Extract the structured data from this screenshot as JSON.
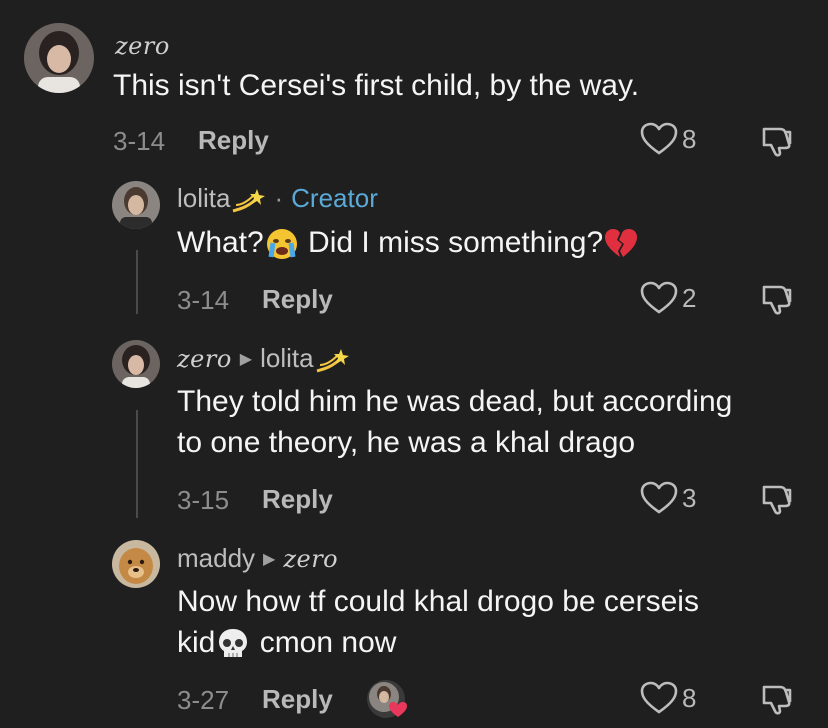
{
  "comments": [
    {
      "username": "zero",
      "text": "This isn't Cersei's first child, by the way.",
      "date": "3-14",
      "reply_label": "Reply",
      "likes": "8"
    },
    {
      "username": "lolita",
      "creator_label": "Creator",
      "text_a": "What?",
      "text_b": " Did I miss something?",
      "date": "3-14",
      "reply_label": "Reply",
      "likes": "2"
    },
    {
      "username": "zero",
      "reply_to": "lolita",
      "text_lines": [
        "They told him he was dead, but according",
        "to one theory, he was a khal drago"
      ],
      "date": "3-15",
      "reply_label": "Reply",
      "likes": "3"
    },
    {
      "username": "maddy",
      "reply_to": "zero",
      "text_line1": "Now how tf could khal drogo be cerseis",
      "text_line2_a": "kid",
      "text_line2_b": " cmon now",
      "date": "3-27",
      "reply_label": "Reply",
      "likes": "8"
    }
  ],
  "icons": {
    "like": "heart-outline-icon",
    "dislike": "thumbs-down-icon",
    "separator": "middle-dot",
    "reply_arrow": "triangle-right-icon"
  },
  "colors": {
    "background": "#1f1f1f",
    "creator": "#5aa9d6",
    "liked_by_creator": "#e8385b"
  }
}
